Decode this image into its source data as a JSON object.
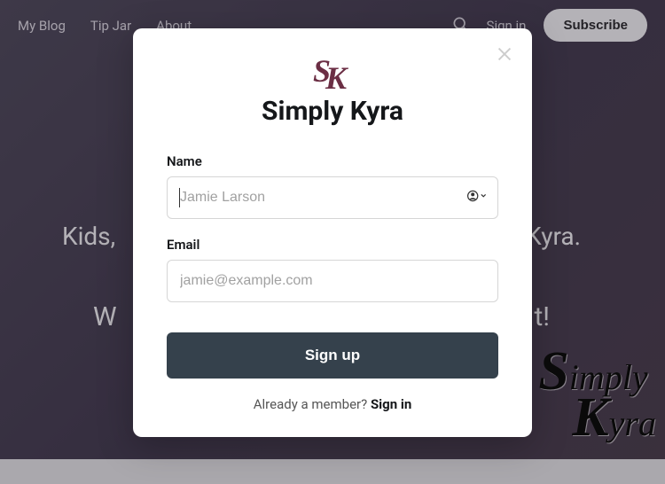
{
  "nav": {
    "items": [
      "My Blog",
      "Tip Jar",
      "About"
    ],
    "signin": "Sign in",
    "subscribe": "Subscribe"
  },
  "hero": {
    "line1_left": "Kids,",
    "line1_right": "Kyra.",
    "line2_left": "W",
    "line2_right": "t!"
  },
  "modal": {
    "title": "Simply Kyra",
    "name_label": "Name",
    "name_placeholder": "Jamie Larson",
    "email_label": "Email",
    "email_placeholder": "jamie@example.com",
    "signup_button": "Sign up",
    "already_text": "Already a member? ",
    "signin_link": "Sign in"
  },
  "watermark": {
    "line1a": "S",
    "line1b": "imply",
    "line2a": "K",
    "line2b": "yra"
  }
}
